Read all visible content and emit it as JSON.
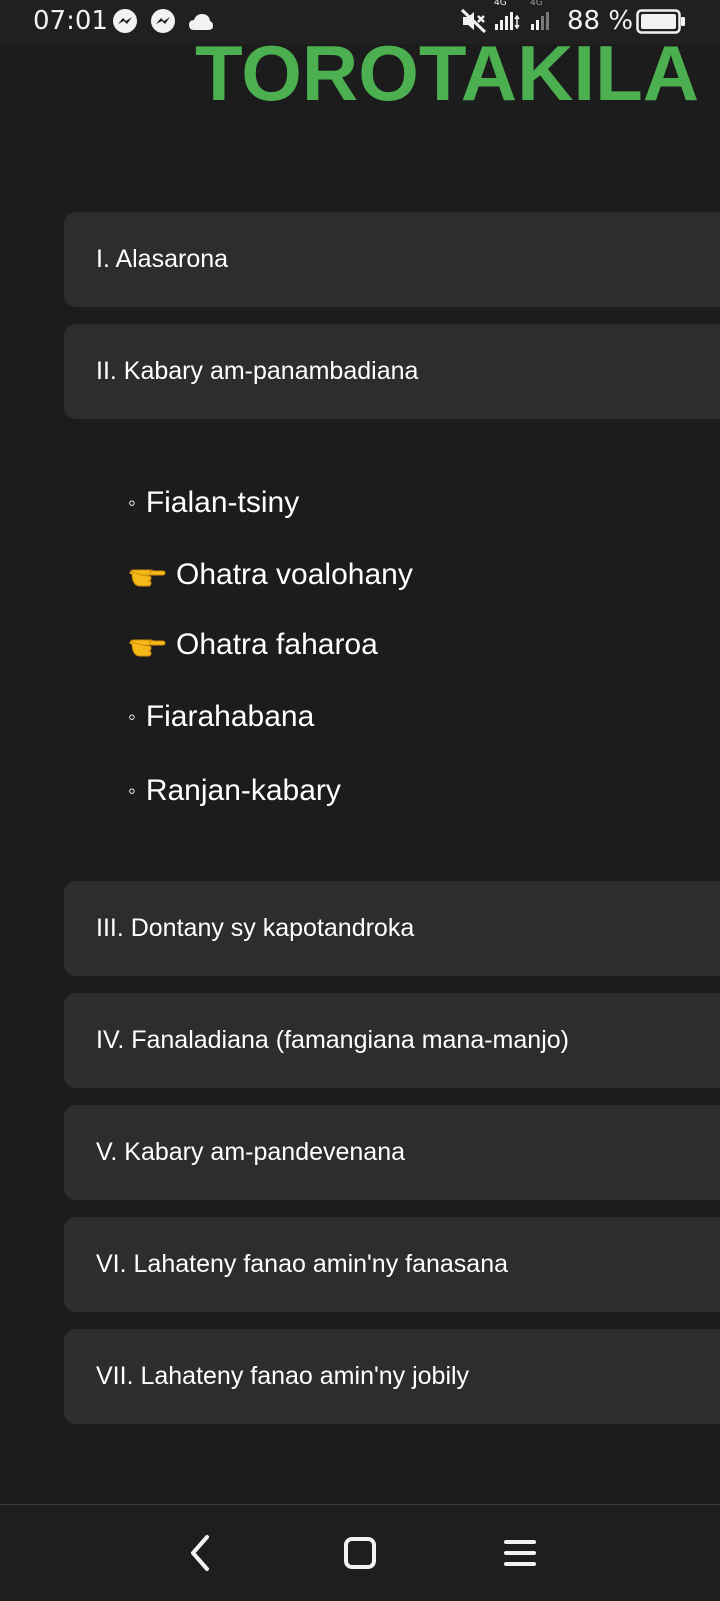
{
  "status_bar": {
    "time": "07:01",
    "battery_text": "88 %",
    "network_1": "4G",
    "network_2": "4G"
  },
  "title": "TOROTAKILA",
  "colors": {
    "title": "#4caf50",
    "background": "#1c1c1c",
    "card": "#2d2d2d"
  },
  "sections_top": [
    {
      "label": "I. Alasarona"
    },
    {
      "label": "II. Kabary am-panambadiana"
    }
  ],
  "sub_items": [
    {
      "label": "Fialan-tsiny",
      "icon": "bullet"
    },
    {
      "label": "Ohatra voalohany",
      "icon": "pointing-hand"
    },
    {
      "label": "Ohatra faharoa",
      "icon": "pointing-hand"
    },
    {
      "label": "Fiarahabana",
      "icon": "bullet"
    },
    {
      "label": "Ranjan-kabary",
      "icon": "bullet"
    }
  ],
  "sections_bottom": [
    {
      "label": "III. Dontany sy kapotandroka"
    },
    {
      "label": "IV. Fanaladiana (famangiana mana-manjo)"
    },
    {
      "label": "V. Kabary am-pandevenana"
    },
    {
      "label": "VI. Lahateny fanao amin'ny fanasana"
    },
    {
      "label": "VII. Lahateny fanao amin'ny jobily"
    }
  ],
  "nav": {
    "back_icon": "back-icon",
    "home_icon": "home-icon",
    "menu_icon": "menu-icon"
  }
}
